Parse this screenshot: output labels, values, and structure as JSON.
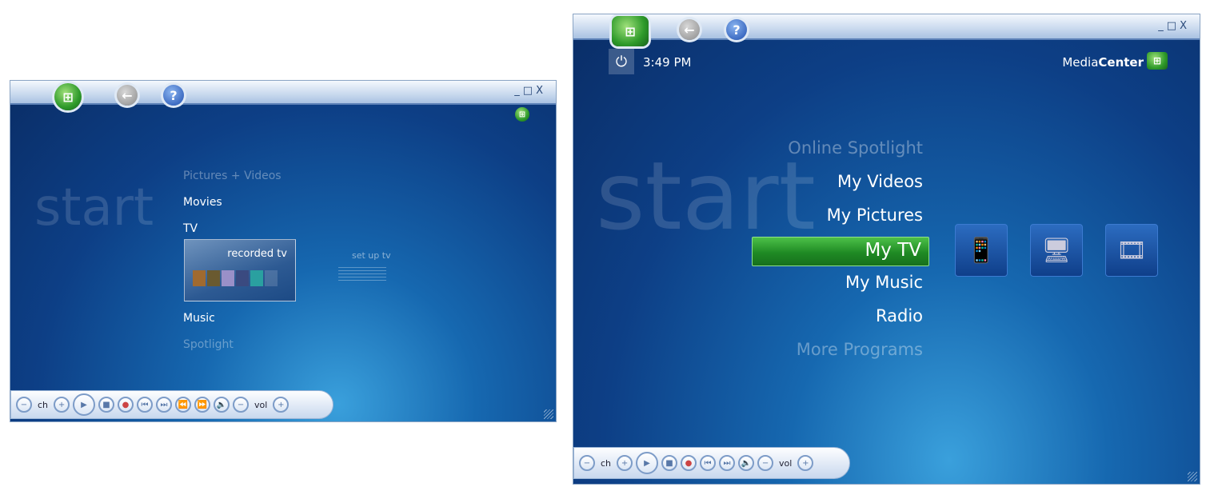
{
  "left_window": {
    "controls": {
      "minimize": "_",
      "maximize": "□",
      "close": "X"
    },
    "start_label": "start",
    "menu": [
      {
        "label": "Pictures + Videos",
        "state": "faded"
      },
      {
        "label": "Movies",
        "state": "normal"
      },
      {
        "label": "TV",
        "state": "normal"
      },
      {
        "label": "Music",
        "state": "normal"
      },
      {
        "label": "Spotlight",
        "state": "faded"
      }
    ],
    "tv_strip": {
      "selected": "recorded tv",
      "next": "set up tv"
    },
    "transport": {
      "ch": "ch",
      "vol": "vol"
    }
  },
  "right_window": {
    "controls": {
      "minimize": "_",
      "maximize": "□",
      "close": "X"
    },
    "clock": "3:49 PM",
    "brand": {
      "prefix": "Media",
      "suffix": "Center"
    },
    "start_label": "start",
    "menu": [
      {
        "label": "Online Spotlight",
        "state": "faded"
      },
      {
        "label": "My Videos",
        "state": "normal"
      },
      {
        "label": "My Pictures",
        "state": "normal"
      },
      {
        "label": "My TV",
        "state": "selected"
      },
      {
        "label": "My Music",
        "state": "normal"
      },
      {
        "label": "Radio",
        "state": "normal"
      },
      {
        "label": "More Programs",
        "state": "faded"
      }
    ],
    "tiles": [
      "remote-icon",
      "tv-monitor-icon",
      "film-reel-icon"
    ],
    "transport": {
      "ch": "ch",
      "vol": "vol"
    },
    "highlight_color": "#2f9a2a"
  }
}
